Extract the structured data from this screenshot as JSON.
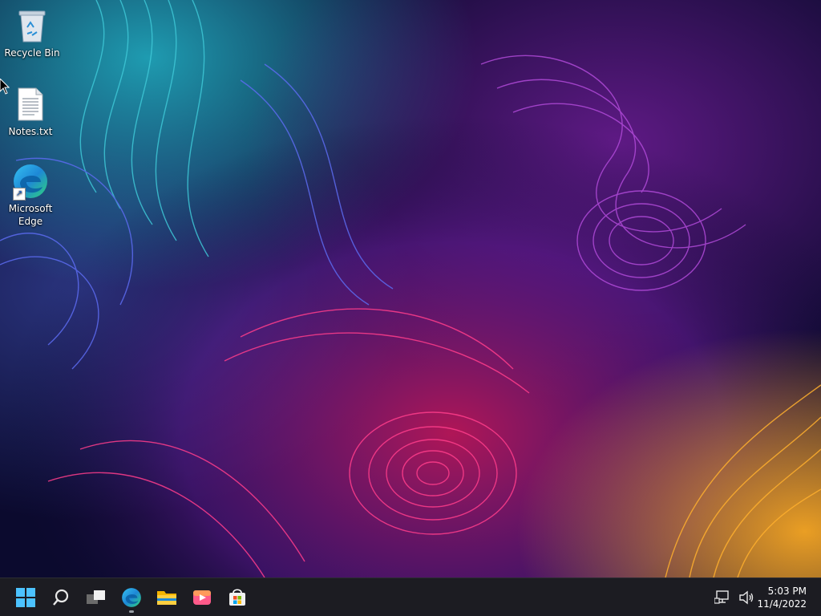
{
  "desktop": {
    "icons": [
      {
        "label": "Recycle Bin",
        "icon": "recycle-bin-icon"
      },
      {
        "label": "Notes.txt",
        "icon": "text-file-icon"
      },
      {
        "label": "Microsoft Edge",
        "icon": "edge-icon"
      }
    ]
  },
  "taskbar": {
    "items": [
      {
        "name": "start",
        "icon": "windows-logo-icon"
      },
      {
        "name": "search",
        "icon": "search-icon"
      },
      {
        "name": "task-view",
        "icon": "task-view-icon"
      },
      {
        "name": "microsoft-edge",
        "icon": "edge-icon",
        "running": true
      },
      {
        "name": "file-explorer",
        "icon": "folder-icon"
      },
      {
        "name": "media-player",
        "icon": "media-player-icon"
      },
      {
        "name": "microsoft-store",
        "icon": "store-icon"
      }
    ],
    "tray": {
      "icons": [
        "network-icon",
        "volume-icon"
      ],
      "time": "5:03 PM",
      "date": "11/4/2022"
    }
  },
  "colors": {
    "taskbar_bg": "#1c1c22",
    "wallpaper_base": "#0b0a2e",
    "accent": "#0078d4"
  }
}
